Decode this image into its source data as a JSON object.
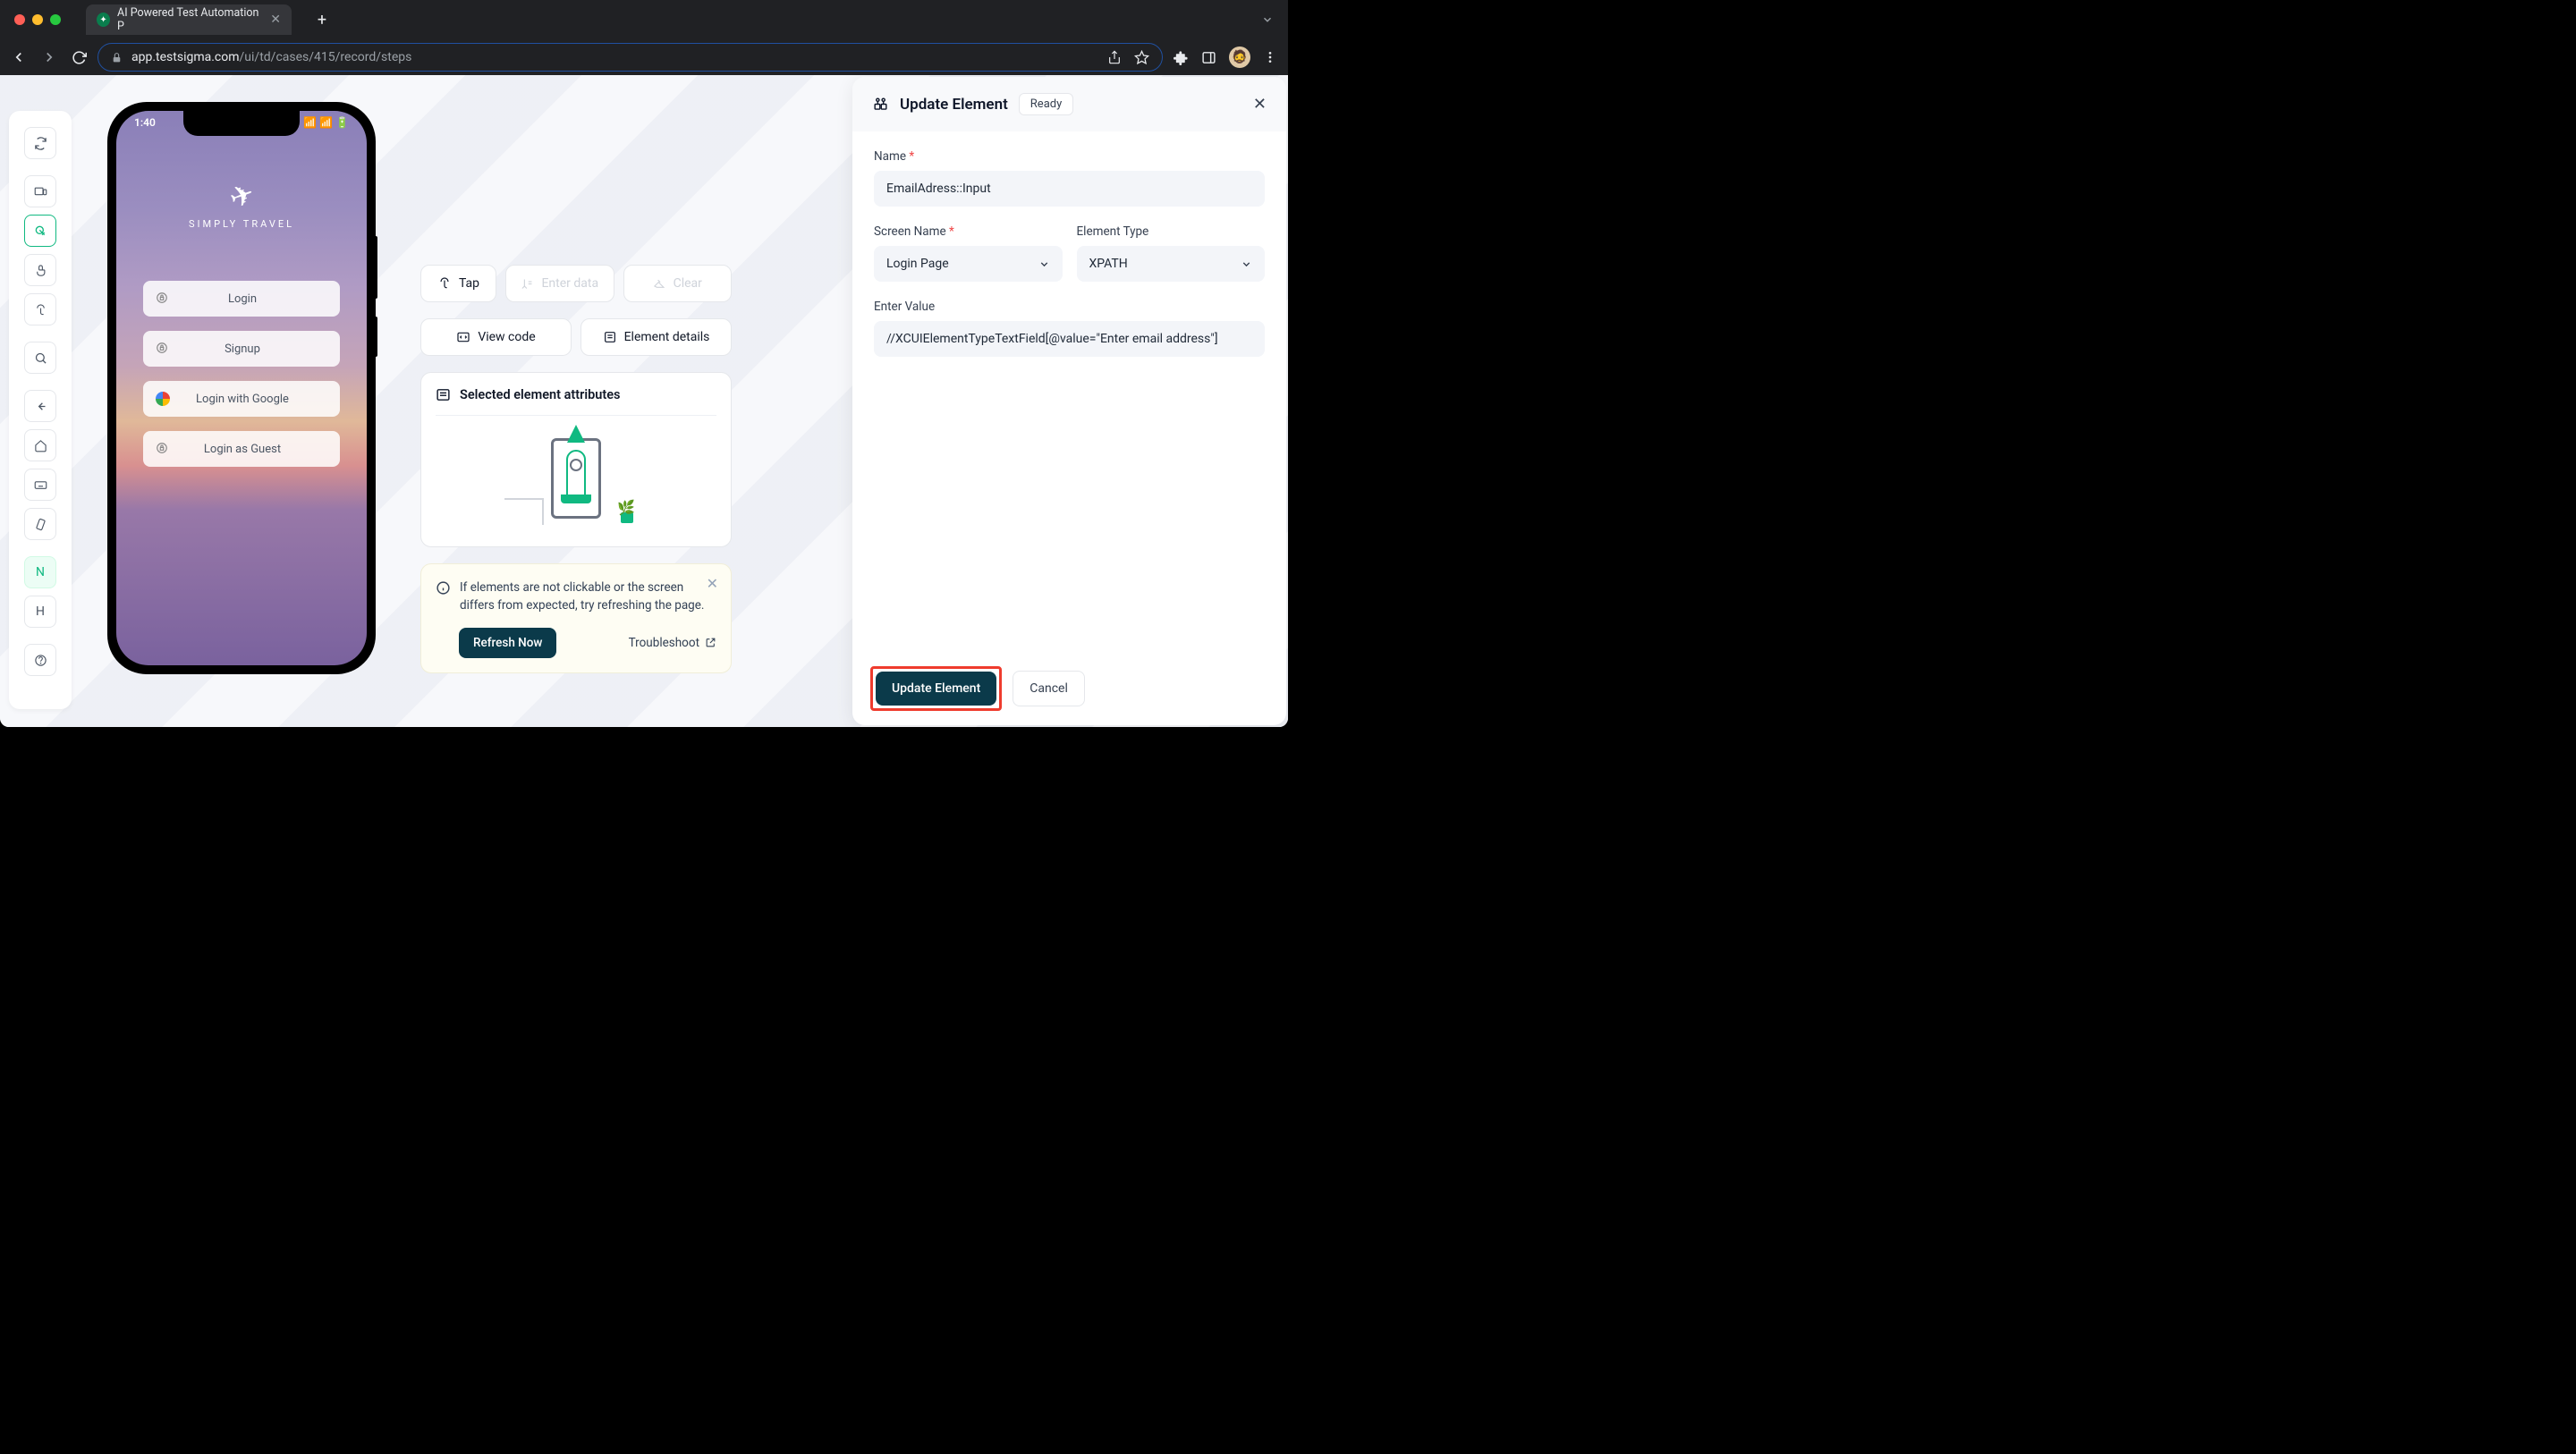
{
  "browser": {
    "tab_title": "AI Powered Test Automation P",
    "url_host": "app.testsigma.com",
    "url_path": "/ui/td/cases/415/record/steps"
  },
  "phone": {
    "time": "1:40",
    "brand": "SIMPLY TRAVEL",
    "buttons": [
      "Login",
      "Signup",
      "Login with Google",
      "Login as Guest"
    ]
  },
  "actions": {
    "tap": "Tap",
    "enter_data": "Enter data",
    "clear": "Clear",
    "view_code": "View code",
    "element_details": "Element details"
  },
  "attributes_card": {
    "title": "Selected element attributes"
  },
  "info": {
    "message": "If elements are not clickable or the screen differs from expected, try refreshing the page.",
    "refresh": "Refresh Now",
    "troubleshoot": "Troubleshoot"
  },
  "panel": {
    "title": "Update Element",
    "badge": "Ready",
    "name_label": "Name",
    "name_value": "EmailAdress::Input",
    "screen_label": "Screen Name",
    "screen_value": "Login Page",
    "type_label": "Element Type",
    "type_value": "XPATH",
    "value_label": "Enter Value",
    "value_value": "//XCUIElementTypeTextField[@value=\"Enter email address\"]",
    "update_btn": "Update Element",
    "cancel_btn": "Cancel"
  },
  "sidebar": {
    "letter1": "N",
    "letter2": "H"
  }
}
